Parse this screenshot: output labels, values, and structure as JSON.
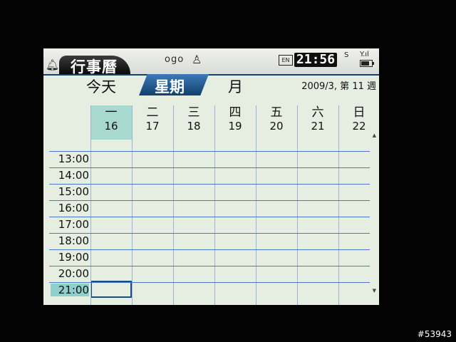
{
  "status_bar": {
    "app_title": "行事曆",
    "ogo_label": "ogo",
    "input_mode": "EN",
    "time": "21:56",
    "status_s": "S",
    "signal": "Y.ıl",
    "battery_level": 0.75
  },
  "view_tabs": {
    "today": "今天",
    "week": "星期",
    "month": "月",
    "active": "week"
  },
  "date_label": "2009/3, 第 11 週",
  "weekdays": [
    {
      "name": "一",
      "date": "16"
    },
    {
      "name": "二",
      "date": "17"
    },
    {
      "name": "三",
      "date": "18"
    },
    {
      "name": "四",
      "date": "19"
    },
    {
      "name": "五",
      "date": "20"
    },
    {
      "name": "六",
      "date": "21"
    },
    {
      "name": "日",
      "date": "22"
    }
  ],
  "hours": [
    "13:00",
    "14:00",
    "15:00",
    "16:00",
    "17:00",
    "18:00",
    "19:00",
    "20:00",
    "21:00"
  ],
  "selected_hour": "21:00",
  "watermark": "#53943",
  "colors": {
    "accent": "#1b4d80",
    "selected_day": "#a8d9d0",
    "background": "#e6eee2"
  }
}
